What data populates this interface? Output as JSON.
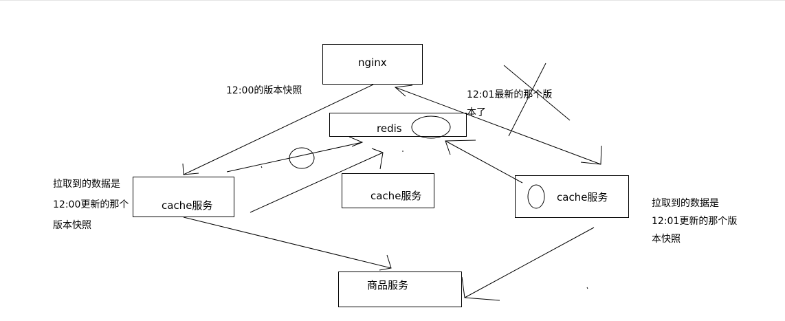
{
  "nodes": {
    "nginx": "nginx",
    "redis": "redis",
    "cache_left": "cache服务",
    "cache_middle": "cache服务",
    "cache_right": "cache服务",
    "product_service": "商品服务"
  },
  "annotations": {
    "snapshot_1200": "12:00的版本快照",
    "latest_1201": "12:01最新的那个版\n本了",
    "left_pulled": "拉取到的数据是\n12:00更新的那个\n版本快照",
    "right_pulled": "拉取到的数据是\n12:01更新的那个版\n本快照"
  }
}
